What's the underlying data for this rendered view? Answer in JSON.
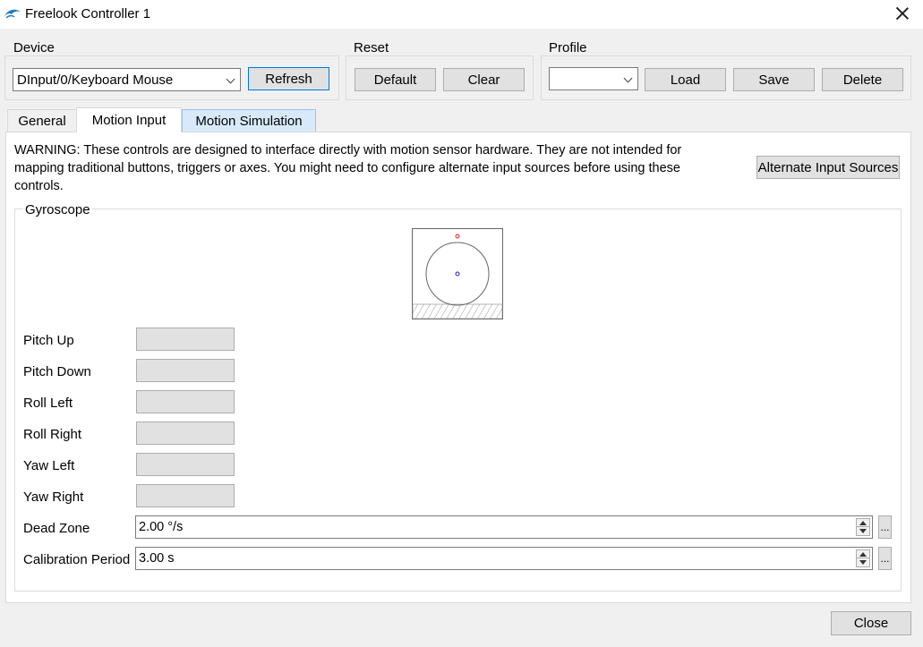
{
  "window": {
    "title": "Freelook Controller 1"
  },
  "device": {
    "label": "Device",
    "selected": "DInput/0/Keyboard Mouse",
    "refresh_label": "Refresh"
  },
  "reset": {
    "label": "Reset",
    "default_label": "Default",
    "clear_label": "Clear"
  },
  "profile": {
    "label": "Profile",
    "selected": "",
    "load_label": "Load",
    "save_label": "Save",
    "delete_label": "Delete"
  },
  "tabs": [
    {
      "label": "General"
    },
    {
      "label": "Motion Input"
    },
    {
      "label": "Motion Simulation"
    }
  ],
  "warning": {
    "text": "WARNING: These controls are designed to interface directly with motion sensor hardware. They are not intended for mapping traditional buttons, triggers or axes. You might need to configure alternate input sources before using these controls.",
    "alt_sources_label": "Alternate Input Sources"
  },
  "gyroscope": {
    "label": "Gyroscope",
    "rows": [
      {
        "label": "Pitch Up",
        "value": ""
      },
      {
        "label": "Pitch Down",
        "value": ""
      },
      {
        "label": "Roll Left",
        "value": ""
      },
      {
        "label": "Roll Right",
        "value": ""
      },
      {
        "label": "Yaw Left",
        "value": ""
      },
      {
        "label": "Yaw Right",
        "value": ""
      }
    ],
    "dead_zone": {
      "label": "Dead Zone",
      "value": "2.00 °/s"
    },
    "calibration": {
      "label": "Calibration Period",
      "value": "3.00 s"
    }
  },
  "footer": {
    "close_label": "Close"
  },
  "colors": {
    "accent": "#0078d7",
    "gyro_red": "#e02020",
    "gyro_blue": "#2020c0"
  }
}
